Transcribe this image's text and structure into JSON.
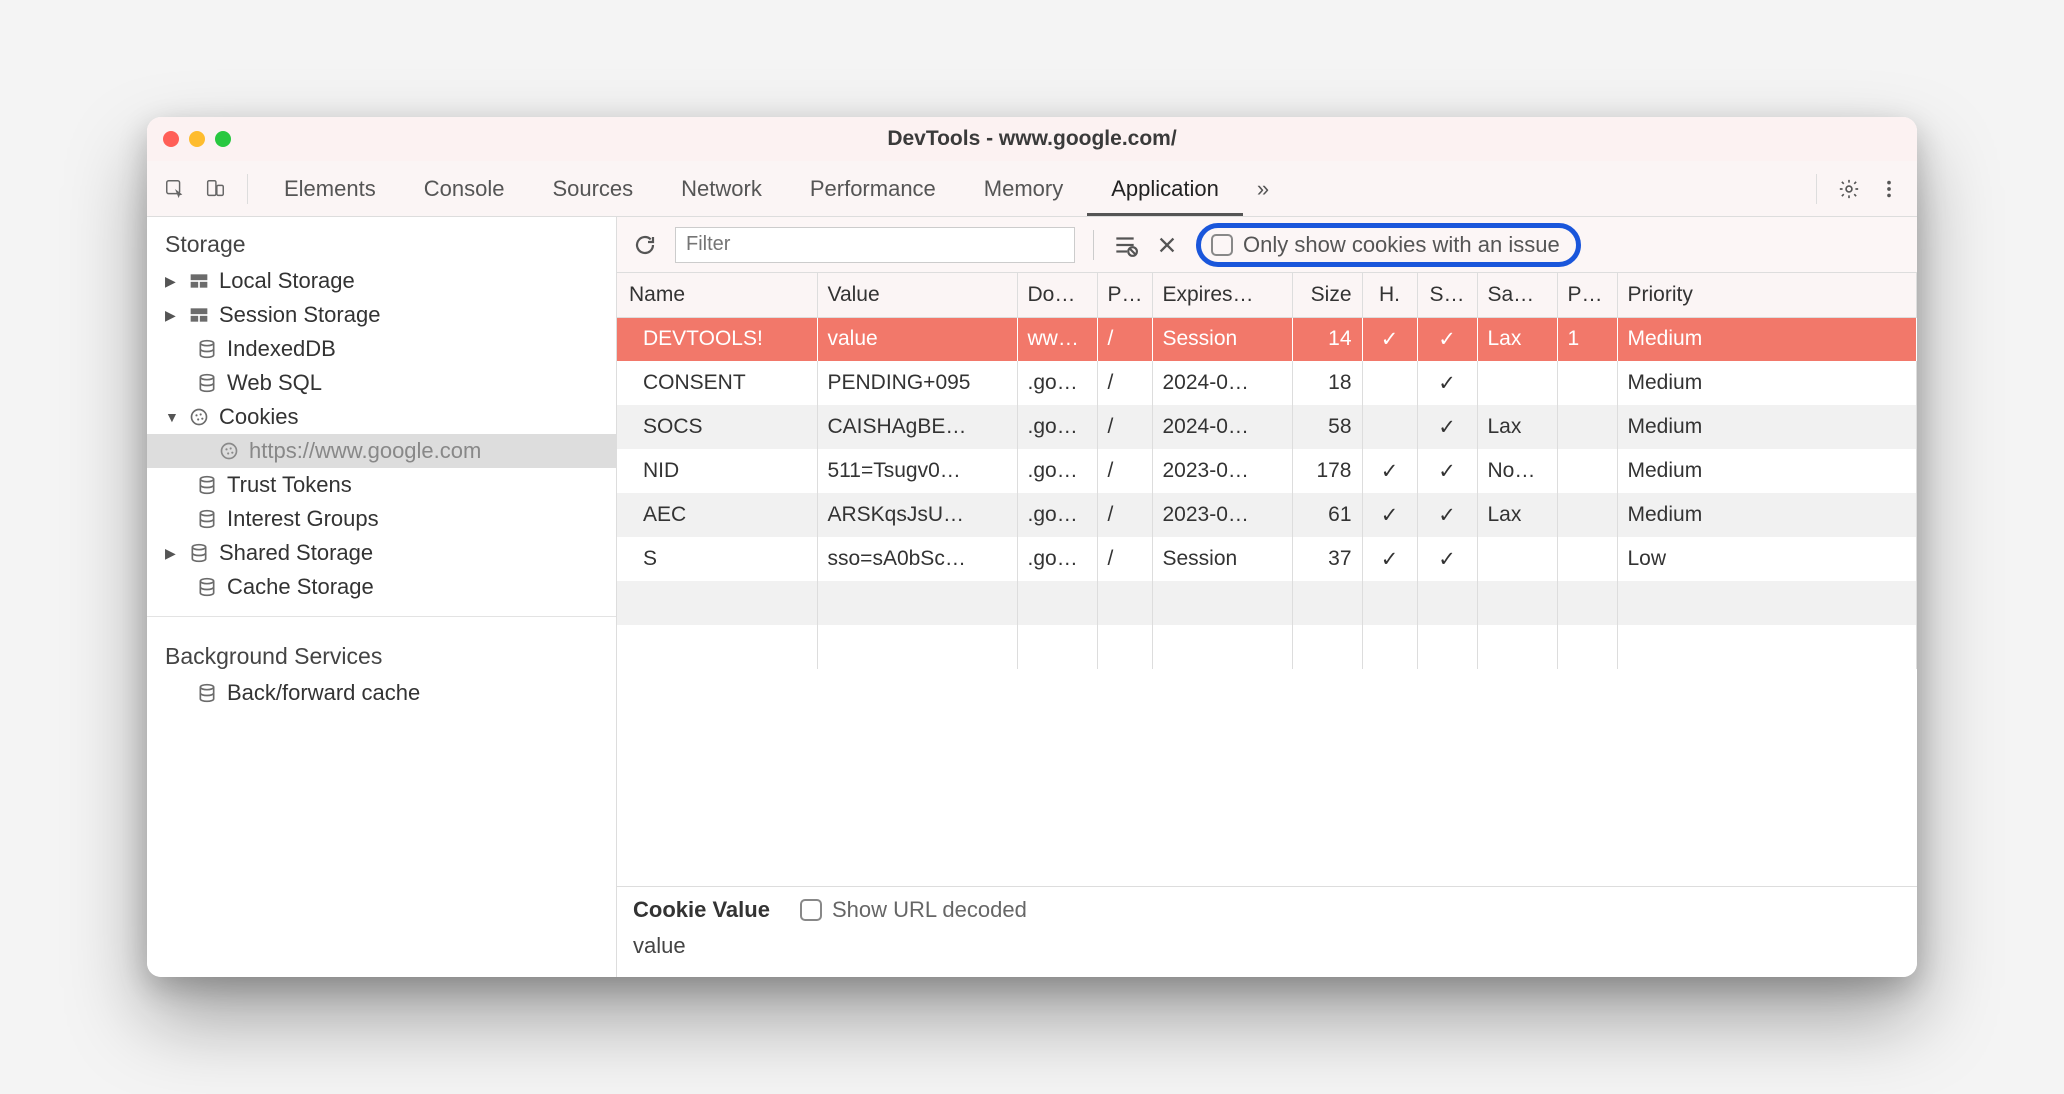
{
  "window": {
    "title": "DevTools - www.google.com/"
  },
  "tabs": {
    "items": [
      "Elements",
      "Console",
      "Sources",
      "Network",
      "Performance",
      "Memory",
      "Application"
    ],
    "active": "Application",
    "overflow": "»"
  },
  "sidebar": {
    "storage_label": "Storage",
    "local_storage": "Local Storage",
    "session_storage": "Session Storage",
    "indexeddb": "IndexedDB",
    "websql": "Web SQL",
    "cookies": "Cookies",
    "cookies_origin": "https://www.google.com",
    "trust_tokens": "Trust Tokens",
    "interest_groups": "Interest Groups",
    "shared_storage": "Shared Storage",
    "cache_storage": "Cache Storage",
    "background_label": "Background Services",
    "bfcache": "Back/forward cache"
  },
  "toolbar": {
    "filter_placeholder": "Filter",
    "only_issue_label": "Only show cookies with an issue"
  },
  "table": {
    "columns": [
      "Name",
      "Value",
      "Do…",
      "P…",
      "Expires…",
      "Size",
      "H.",
      "S…",
      "Sa…",
      "P…",
      "Priority"
    ],
    "rows": [
      {
        "name": "DEVTOOLS!",
        "value": "value",
        "domain": "ww…",
        "path": "/",
        "expires": "Session",
        "size": "14",
        "http": "✓",
        "secure": "✓",
        "samesite": "Lax",
        "partition": "1",
        "priority": "Medium",
        "highlight": true
      },
      {
        "name": "CONSENT",
        "value": "PENDING+095",
        "domain": ".go…",
        "path": "/",
        "expires": "2024-0…",
        "size": "18",
        "http": "",
        "secure": "✓",
        "samesite": "",
        "partition": "",
        "priority": "Medium"
      },
      {
        "name": "SOCS",
        "value": "CAISHAgBE…",
        "domain": ".go…",
        "path": "/",
        "expires": "2024-0…",
        "size": "58",
        "http": "",
        "secure": "✓",
        "samesite": "Lax",
        "partition": "",
        "priority": "Medium"
      },
      {
        "name": "NID",
        "value": "511=Tsugv0…",
        "domain": ".go…",
        "path": "/",
        "expires": "2023-0…",
        "size": "178",
        "http": "✓",
        "secure": "✓",
        "samesite": "No…",
        "partition": "",
        "priority": "Medium"
      },
      {
        "name": "AEC",
        "value": "ARSKqsJsU…",
        "domain": ".go…",
        "path": "/",
        "expires": "2023-0…",
        "size": "61",
        "http": "✓",
        "secure": "✓",
        "samesite": "Lax",
        "partition": "",
        "priority": "Medium"
      },
      {
        "name": "S",
        "value": "sso=sA0bSc…",
        "domain": ".go…",
        "path": "/",
        "expires": "Session",
        "size": "37",
        "http": "✓",
        "secure": "✓",
        "samesite": "",
        "partition": "",
        "priority": "Low"
      }
    ]
  },
  "detail": {
    "label": "Cookie Value",
    "decoded_label": "Show URL decoded",
    "value": "value"
  }
}
